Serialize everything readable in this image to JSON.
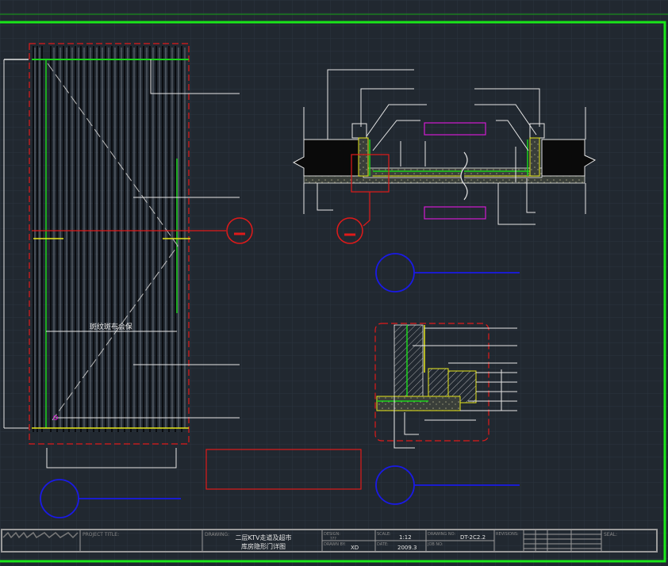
{
  "drawing": {
    "door_caption": "斑纹斑布会保",
    "section_label_1": "",
    "section_label_2": ""
  },
  "title_block": {
    "project_title_label": "PROJECT TITLE:",
    "drawing_label": "DRAWING:",
    "drawing_name_line1": "二层KTV走道及超市",
    "drawing_name_line2": "库房隐形门详图",
    "designed_label": "DESIGN:",
    "designed_value": "???",
    "drawn_label": "DRAWN BY:",
    "drawn_value": "XD",
    "scale_label": "SCALE:",
    "scale_value": "1:12",
    "date_label": "DATE:",
    "date_value": "2009.3",
    "drawing_no_label": "DRAWING NO:",
    "drawing_no_value": "DT-2C2.2",
    "job_no_label": "JOB NO:",
    "revisions_label": "REVISIONS:",
    "seal_label": "SEAL:"
  },
  "colors": {
    "background": "#212830",
    "grid": "#2b333c",
    "frame": "#19e619",
    "red_dash": "#e01a1a",
    "yellow": "#e6e61a",
    "green": "#1ad21a",
    "blue": "#1a1ae6",
    "magenta": "#d21ad2",
    "white": "#e6e6e6"
  }
}
